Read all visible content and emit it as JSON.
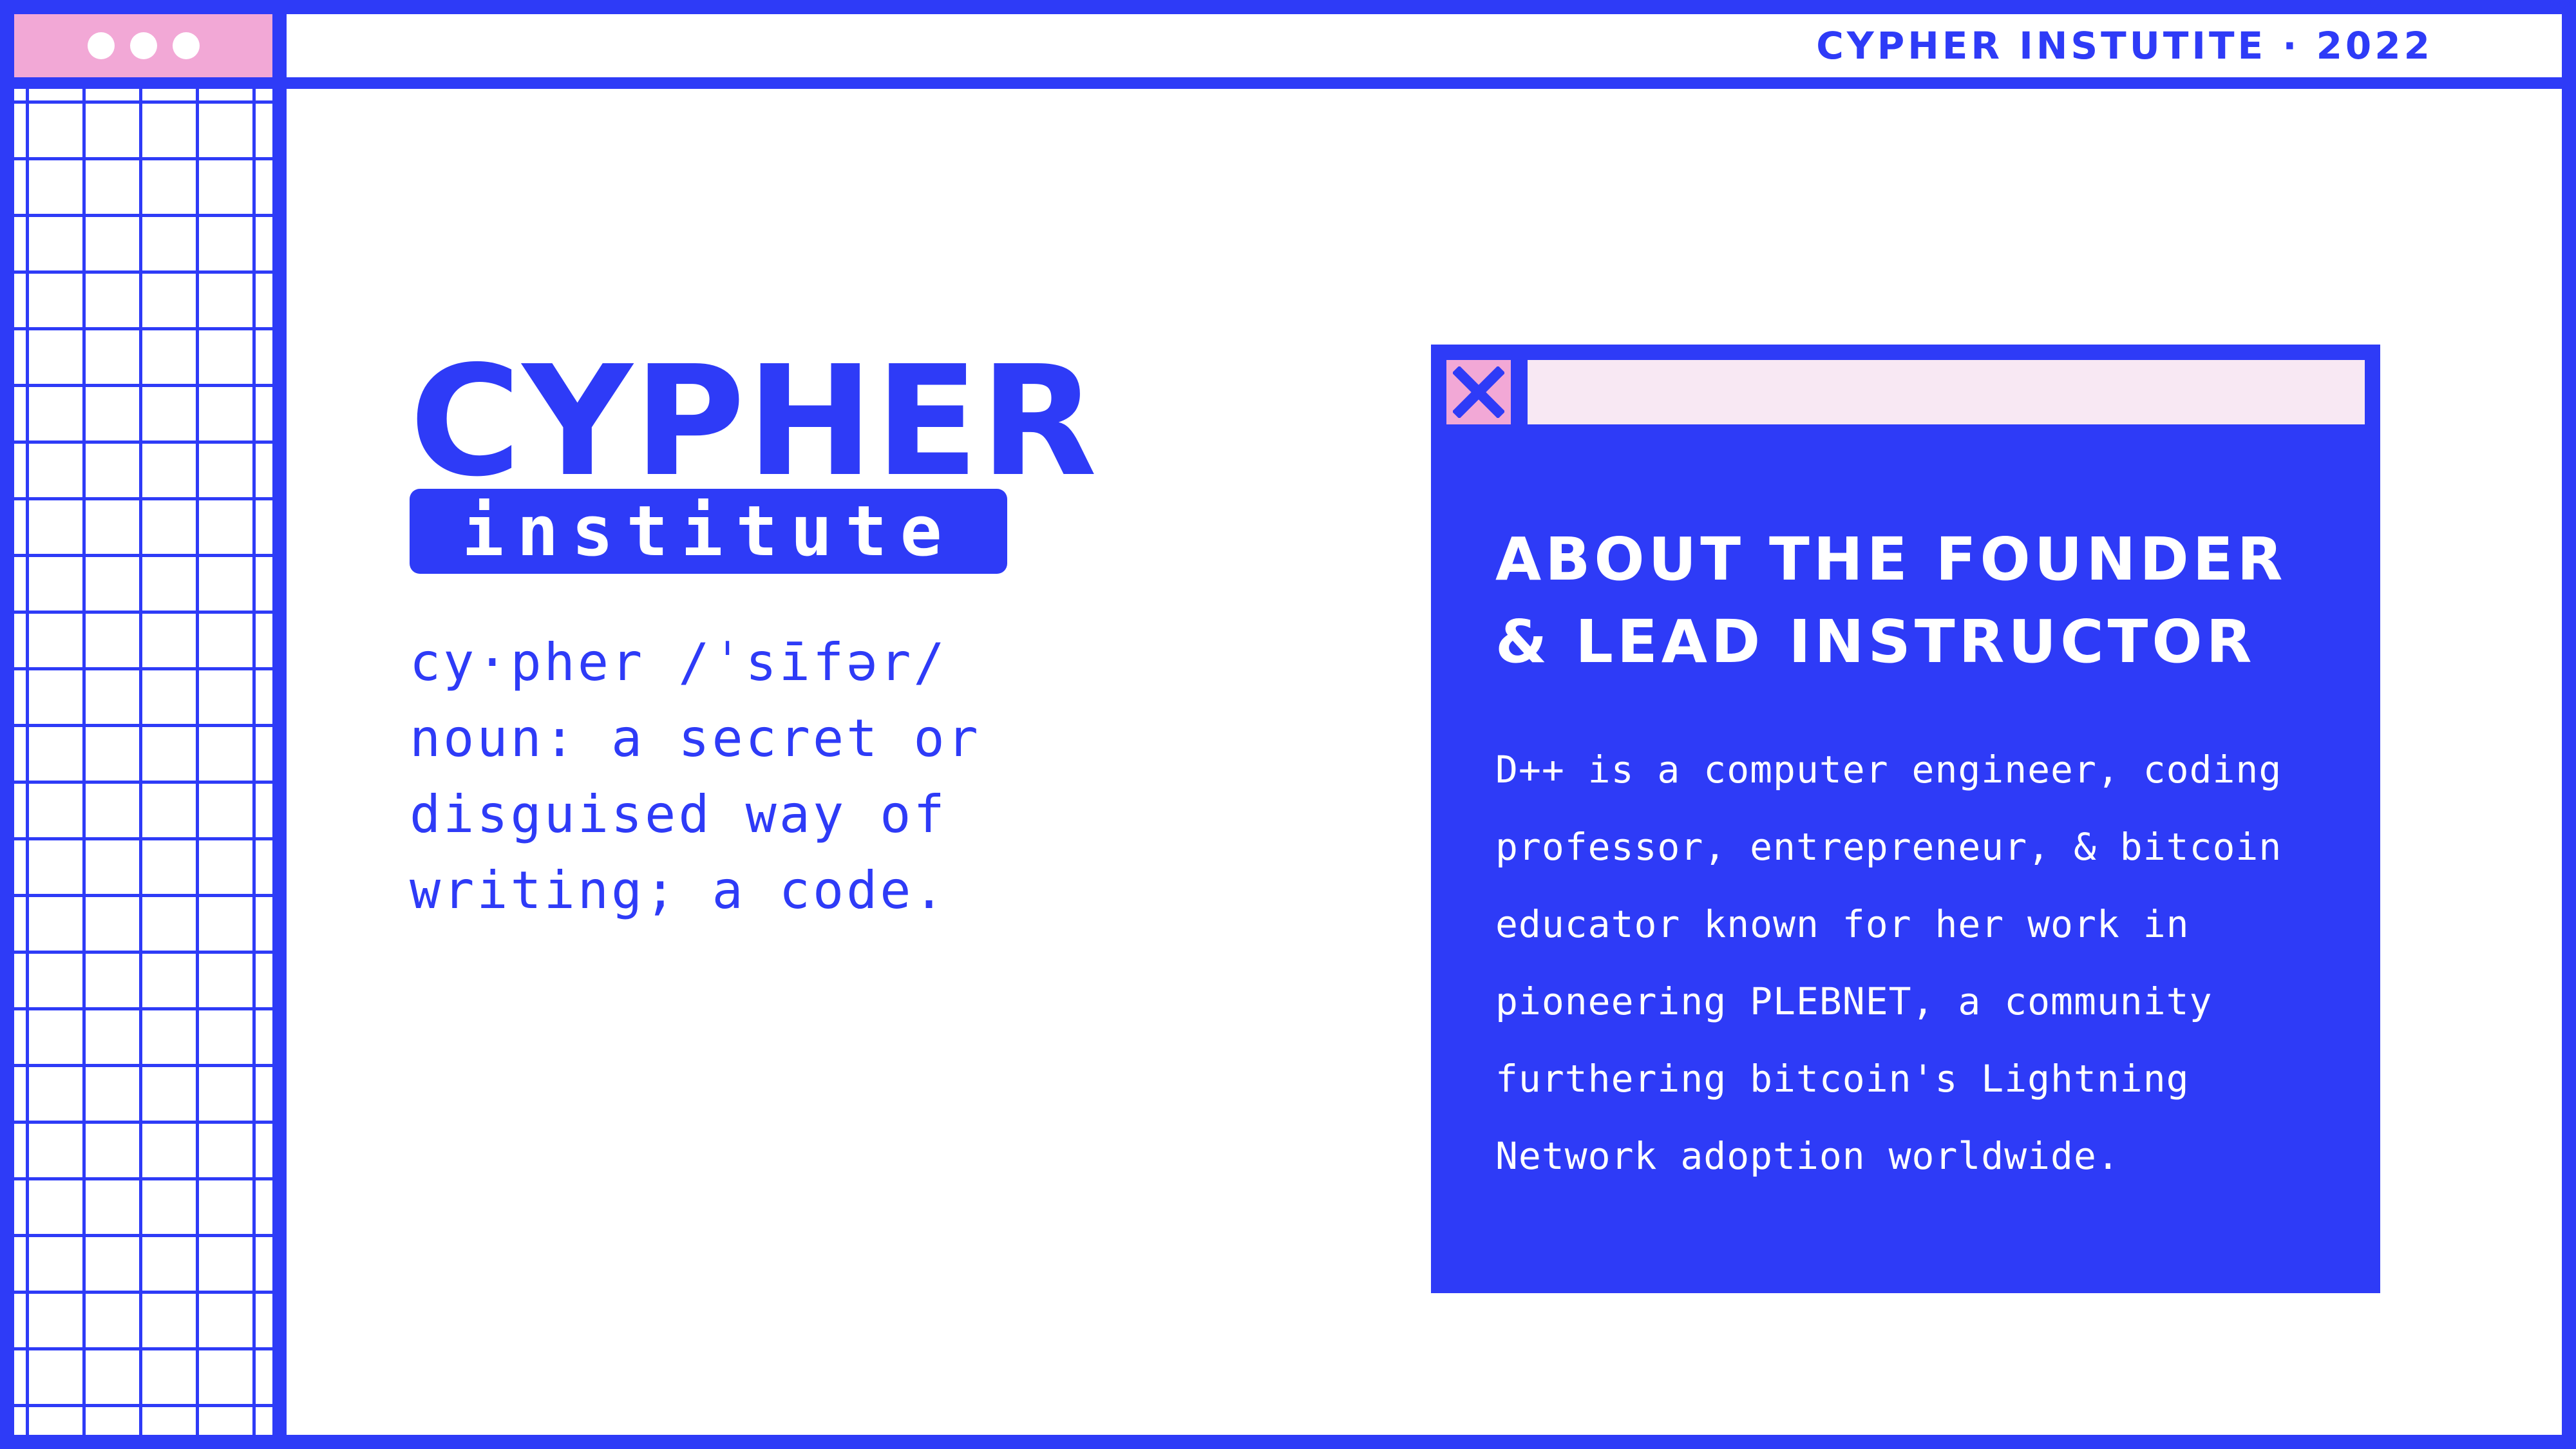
{
  "header": {
    "title": "CYPHER INSTUTITE · 2022"
  },
  "logo": {
    "word": "CYPHER",
    "badge": "institute"
  },
  "definition": {
    "lines": [
      "cy·pher /ˈsīfər/",
      "noun: a secret or",
      "disguised way of",
      "writing; a code."
    ]
  },
  "card": {
    "close_icon": "close-x-icon",
    "title_lines": [
      "ABOUT THE FOUNDER",
      "& LEAD INSTRUCTOR"
    ],
    "body_lines": [
      "D++ is a computer engineer, coding",
      "professor, entrepreneur, & bitcoin",
      "educator known for her work in",
      "pioneering PLEBNET, a community",
      "furthering bitcoin's Lightning",
      "Network adoption worldwide."
    ]
  },
  "colors": {
    "primary": "#2e3bf7",
    "pink": "#f2a8d6",
    "light_pink": "#f8e8f3",
    "background": "#ffffff"
  }
}
